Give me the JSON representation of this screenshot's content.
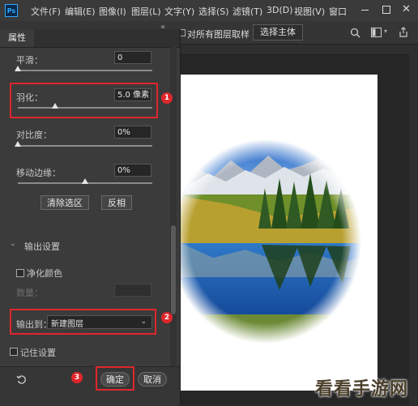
{
  "menu": {
    "logo": "Ps",
    "items": [
      "文件(F)",
      "编辑(E)",
      "图像(I)",
      "图层(L)",
      "文字(Y)",
      "选择(S)",
      "滤镜(T)",
      "3D(D)",
      "视图(V)",
      "窗口"
    ]
  },
  "options_bar": {
    "panel_collapse": "«",
    "panel_menu": "≡",
    "sample_all_layers": "对所有图层取样",
    "select_subject": "选择主体"
  },
  "panel": {
    "tab": "属性",
    "smooth": {
      "label": "平滑：",
      "value": "0",
      "level": 0
    },
    "feather": {
      "label": "羽化：",
      "value": "5.0 像素",
      "level": 0.28
    },
    "contrast": {
      "label": "对比度：",
      "value": "0%",
      "level": 0
    },
    "shift_edge": {
      "label": "移动边缘：",
      "value": "0%",
      "level": 0.5
    },
    "clear_selection": "清除选区",
    "invert": "反相",
    "output_settings": "输出设置",
    "decontaminate": "净化颜色",
    "amount": "数量：",
    "output_to_label": "输出到：",
    "output_to_value": "新建图层",
    "remember": "记住设置",
    "ok": "确定",
    "cancel": "取消"
  },
  "annotations": {
    "badge1": "1",
    "badge2": "2",
    "badge3": "3"
  },
  "watermark": "看看手游网",
  "colors": {
    "accent": "#e0262c",
    "ps_blue": "#31a8ff",
    "panel_bg": "#3b3b3b"
  }
}
